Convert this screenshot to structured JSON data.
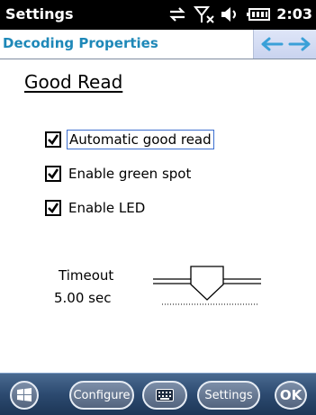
{
  "statusbar": {
    "title": "Settings",
    "time": "2:03",
    "icons": [
      "connectivity-icon",
      "no-signal-icon",
      "speaker-icon",
      "battery-icon"
    ]
  },
  "header": {
    "title": "Decoding Properties",
    "nav": [
      "back-arrow-icon",
      "forward-arrow-icon"
    ]
  },
  "content": {
    "section_title": "Good Read",
    "checkboxes": [
      {
        "label": "Automatic good read",
        "checked": true,
        "focused": true
      },
      {
        "label": "Enable green spot",
        "checked": true,
        "focused": false
      },
      {
        "label": "Enable LED",
        "checked": true,
        "focused": false
      }
    ],
    "timeout": {
      "label": "Timeout",
      "value": "5.00 sec",
      "slider_position": 0.55
    }
  },
  "bottombar": {
    "configure_label": "Configure",
    "settings_label": "Settings",
    "ok_label": "OK",
    "icons": [
      "windows-start-icon",
      "keyboard-icon"
    ]
  },
  "colors": {
    "statusbar_bg": "#000000",
    "header_title": "#1e88b8",
    "nav_arrow": "#3aa0d8",
    "bottombar_bg": "#2c4a70"
  }
}
